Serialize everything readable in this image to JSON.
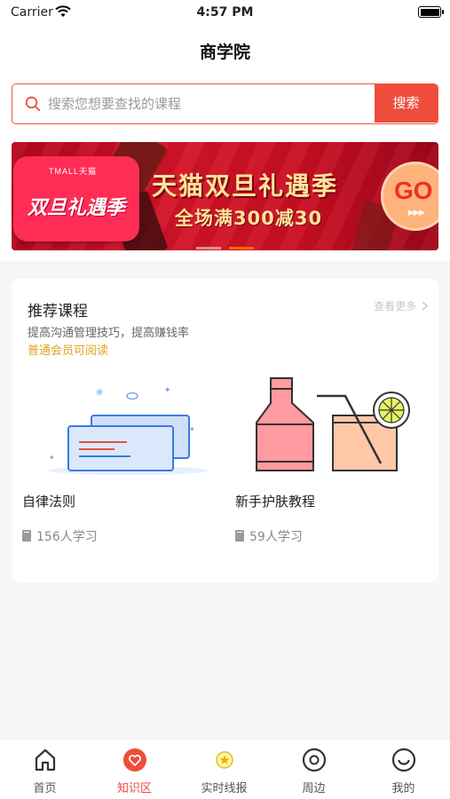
{
  "status_bar": {
    "carrier": "Carrier",
    "time": "4:57 PM"
  },
  "nav": {
    "title": "商学院"
  },
  "search": {
    "placeholder": "搜索您想要查找的课程",
    "value": "",
    "button_label": "搜索",
    "accent_color": "#ee4d3c"
  },
  "banner": {
    "brand_text": "TMALL天猫",
    "sale_name": "双旦礼遇季",
    "headline": "天猫双旦礼遇季",
    "subline": "全场满300减30",
    "go_label": "GO",
    "go_arrows": "▶▶▶"
  },
  "recommended": {
    "title": "推荐课程",
    "more_label": "查看更多",
    "subtitle": "提高沟通管理技巧，提高赚钱率",
    "member_note": "普通会员可阅读",
    "courses": [
      {
        "name": "自律法则",
        "learners": "156人学习",
        "thumb_icon": "documents-illustration"
      },
      {
        "name": "新手护肤教程",
        "learners": "59人学习",
        "thumb_icon": "drinks-illustration"
      }
    ]
  },
  "tabs": [
    {
      "label": "首页",
      "icon": "home-icon",
      "active": false
    },
    {
      "label": "知识区",
      "icon": "heart-icon",
      "active": true
    },
    {
      "label": "实时线报",
      "icon": "star-badge-icon",
      "active": false
    },
    {
      "label": "周边",
      "icon": "compass-icon",
      "active": false
    },
    {
      "label": "我的",
      "icon": "smile-icon",
      "active": false
    }
  ]
}
